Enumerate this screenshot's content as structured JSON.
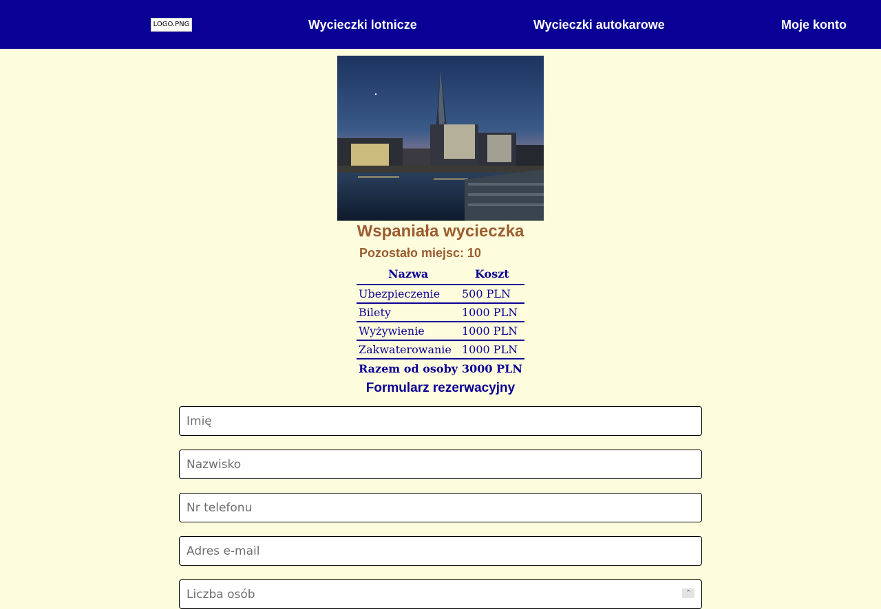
{
  "nav": {
    "logo_alt": "LOGO.PNG",
    "links": [
      {
        "label": "Wycieczki lotnicze"
      },
      {
        "label": "Wycieczki autokarowe"
      },
      {
        "label": "Moje konto"
      }
    ]
  },
  "trip": {
    "title": "Wspaniała wycieczka",
    "seats_left": "Pozostało miejsc: 10"
  },
  "cost_table": {
    "headers": [
      "Nazwa",
      "Koszt"
    ],
    "rows": [
      {
        "name": "Ubezpieczenie",
        "cost": "500 PLN"
      },
      {
        "name": "Bilety",
        "cost": "1000 PLN"
      },
      {
        "name": "Wyżywienie",
        "cost": "1000 PLN"
      },
      {
        "name": "Zakwaterowanie",
        "cost": "1000 PLN"
      }
    ],
    "total_label": "Razem od osoby",
    "total_value": "3000 PLN"
  },
  "form": {
    "title": "Formularz rezerwacyjny",
    "fields": [
      {
        "placeholder": "Imię",
        "value": ""
      },
      {
        "placeholder": "Nazwisko",
        "value": ""
      },
      {
        "placeholder": "Nr telefonu",
        "value": ""
      },
      {
        "placeholder": "Adres e-mail",
        "value": ""
      },
      {
        "placeholder": "Liczba osób",
        "value": ""
      }
    ]
  },
  "colors": {
    "navbar": "#0a0096",
    "background": "#fdfcdc",
    "accent_brown": "#9b5c30",
    "table_text": "#0a0096"
  }
}
